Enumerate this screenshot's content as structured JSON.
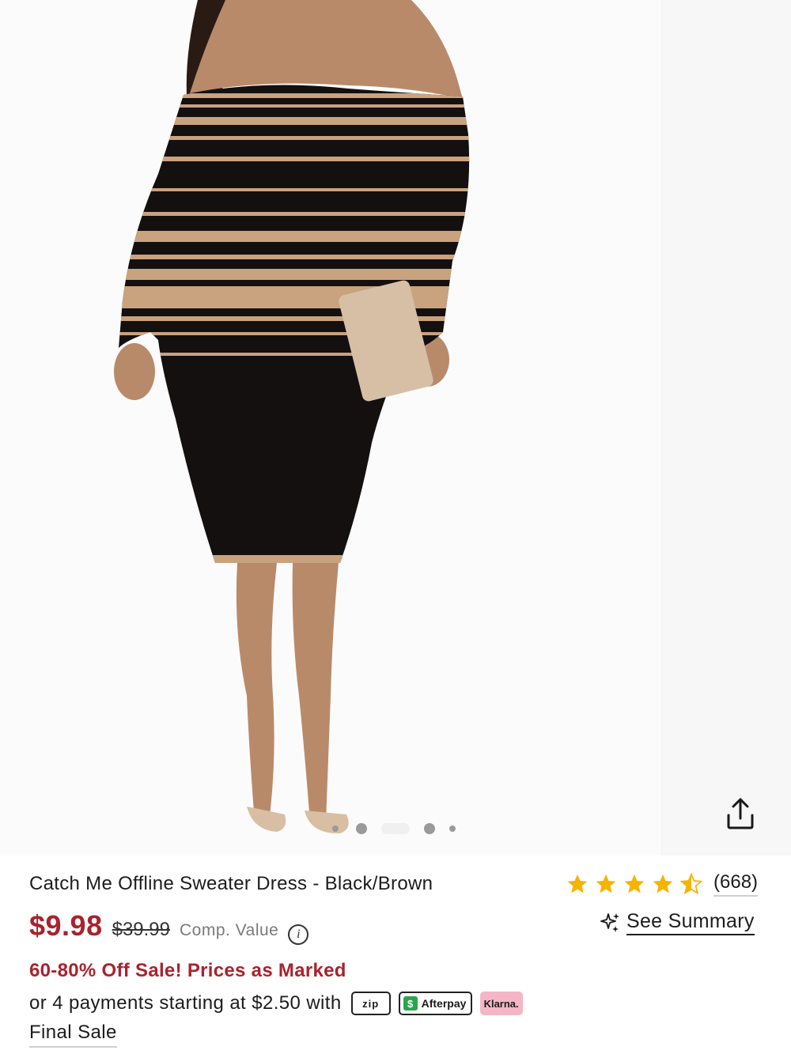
{
  "product": {
    "title": "Catch Me Offline Sweater Dress - Black/Brown",
    "sale_price": "$9.98",
    "original_price": "$39.99",
    "comp_value_label": "Comp. Value",
    "promo": "60-80% Off Sale! Prices as Marked",
    "installments_text": "or 4 payments starting at $2.50 with",
    "final_sale": "Final Sale"
  },
  "rating": {
    "stars": 4.5,
    "review_count": "(668)",
    "star_color": "#f5b400"
  },
  "summary": {
    "label": "See Summary",
    "icon": "sparkle-icon"
  },
  "payment_badges": {
    "zip": "zip",
    "afterpay": "Afterpay",
    "klarna": "Klarna."
  },
  "gallery": {
    "image_count": 5,
    "active_index": 2,
    "share_icon": "share-icon"
  },
  "colors": {
    "sale_red": "#a8232e",
    "dress_black": "#141010",
    "dress_tan": "#c9a27e"
  }
}
